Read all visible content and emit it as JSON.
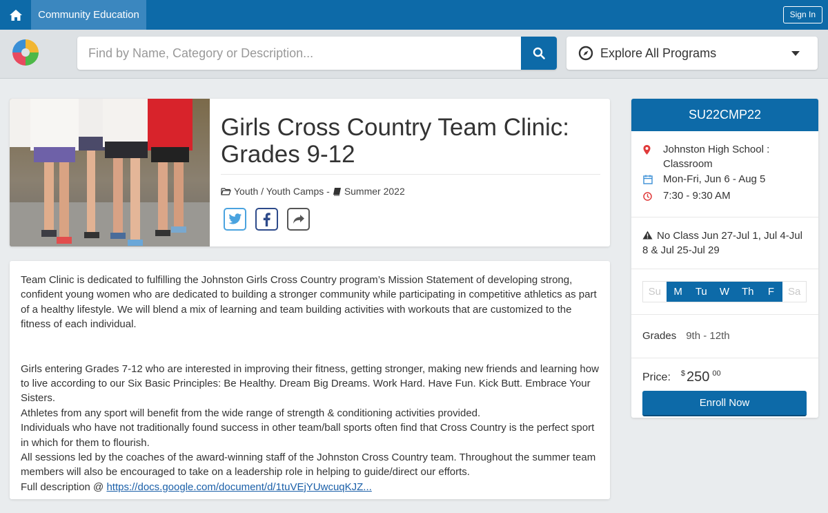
{
  "nav": {
    "tab_label": "Community Education",
    "signin_label": "Sign In"
  },
  "search": {
    "placeholder": "Find by Name, Category or Description...",
    "value": ""
  },
  "explore": {
    "label": "Explore All Programs"
  },
  "program": {
    "title": "Girls Cross Country Team Clinic: Grades 9-12",
    "category": "Youth / Youth Camps -",
    "term": "Summer 2022"
  },
  "description": {
    "p1": "Team Clinic is dedicated to fulfilling the Johnston Girls Cross Country program’s Mission Statement of developing strong, confident young women who are dedicated to building a stronger community while participating in competitive athletics as part of a healthy lifestyle. We will blend a mix of learning and team building activities with workouts that are customized to the fitness of each individual.",
    "lines": [
      "Girls entering Grades 7-12 who are interested in improving their fitness, getting stronger, making new friends and learning how to live according to our Six Basic Principles: Be Healthy. Dream Big Dreams. Work Hard. Have Fun. Kick Butt. Embrace Your Sisters.",
      "Athletes from any sport will benefit from the wide range of strength & conditioning activities provided.",
      "Individuals who have not traditionally found success in other team/ball sports often find that Cross Country is the perfect sport in which for them to flourish.",
      "All sessions led by the coaches of the award-winning staff of the Johnston Cross Country team. Throughout the summer team members will also be encouraged to take on a leadership role in helping to guide/direct our efforts."
    ],
    "full_prefix": "Full description @ ",
    "full_link": "https://docs.google.com/document/d/1tuVEjYUwcuqKJZ..."
  },
  "sidebar": {
    "code": "SU22CMP22",
    "location": "Johnston High School : Classroom",
    "dates": "Mon-Fri, Jun 6 - Aug 5",
    "time": "7:30 - 9:30 AM",
    "notice": "No Class Jun 27-Jul 1, Jul 4-Jul 8 & Jul 25-Jul 29",
    "days": [
      {
        "label": "Su",
        "active": false
      },
      {
        "label": "M",
        "active": true
      },
      {
        "label": "Tu",
        "active": true
      },
      {
        "label": "W",
        "active": true
      },
      {
        "label": "Th",
        "active": true
      },
      {
        "label": "F",
        "active": true
      },
      {
        "label": "Sa",
        "active": false
      }
    ],
    "grades_label": "Grades",
    "grades_value": "9th - 12th",
    "price_label": "Price:",
    "price_currency": "$",
    "price_dollars": "250",
    "price_cents": "00",
    "enroll_label": "Enroll Now"
  },
  "colors": {
    "primary": "#0d6aa8",
    "tab_active": "#3b87bf",
    "background": "#e9ecee",
    "twitter": "#4aa3df",
    "facebook": "#2d4a8a",
    "share": "#555555"
  },
  "icons": [
    "home-icon",
    "search-icon",
    "compass-icon",
    "caret-down-icon",
    "folder-icon",
    "book-icon",
    "twitter-icon",
    "facebook-icon",
    "share-icon",
    "map-marker-icon",
    "calendar-icon",
    "clock-icon",
    "warning-icon"
  ]
}
